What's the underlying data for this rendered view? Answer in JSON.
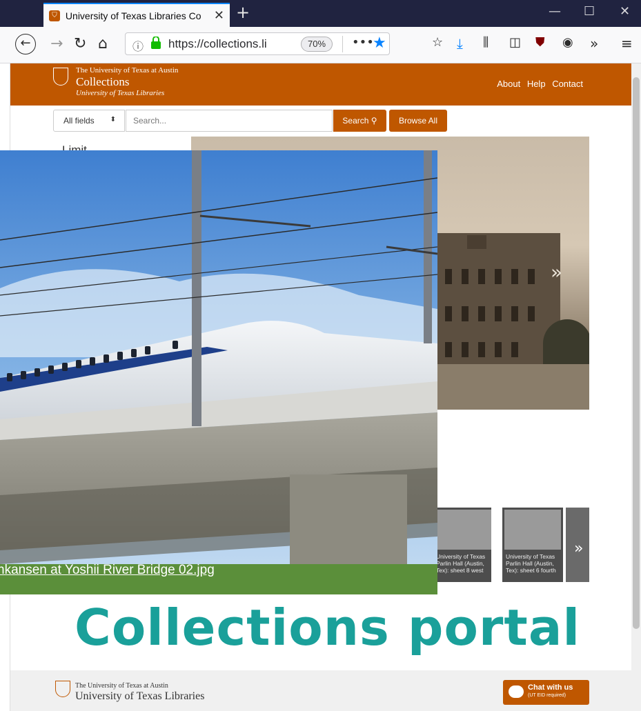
{
  "browser": {
    "tab_title": "University of Texas Libraries Co",
    "url": "https://collections.li",
    "zoom": "70%"
  },
  "header": {
    "institution": "The University of Texas at Austin",
    "site_name": "Collections",
    "sub_name": "University of Texas Libraries",
    "nav": [
      "About",
      "Help",
      "Contact"
    ]
  },
  "search": {
    "field_select": "All fields",
    "placeholder": "Search...",
    "search_label": "Search",
    "browse_label": "Browse All"
  },
  "sidebar": {
    "limit_label": "Limit"
  },
  "thumbnails": [
    "University of Texas Parlin Hall (Austin, Tex): sheet 8 west",
    "University of Texas Parlin Hall (Austin, Tex): sheet 6 fourth"
  ],
  "overlay": {
    "caption": "nkansen at Yoshii River Bridge 02.jpg"
  },
  "banner": {
    "title": "Collections portal"
  },
  "footer": {
    "institution": "The University of Texas at Austin",
    "name": "University of Texas Libraries",
    "chat_title": "Chat with us",
    "chat_sub": "(UT EID required)"
  },
  "colors": {
    "ut_orange": "#bf5700",
    "title_teal": "#1aa09a",
    "chrome_dark": "#202340"
  }
}
